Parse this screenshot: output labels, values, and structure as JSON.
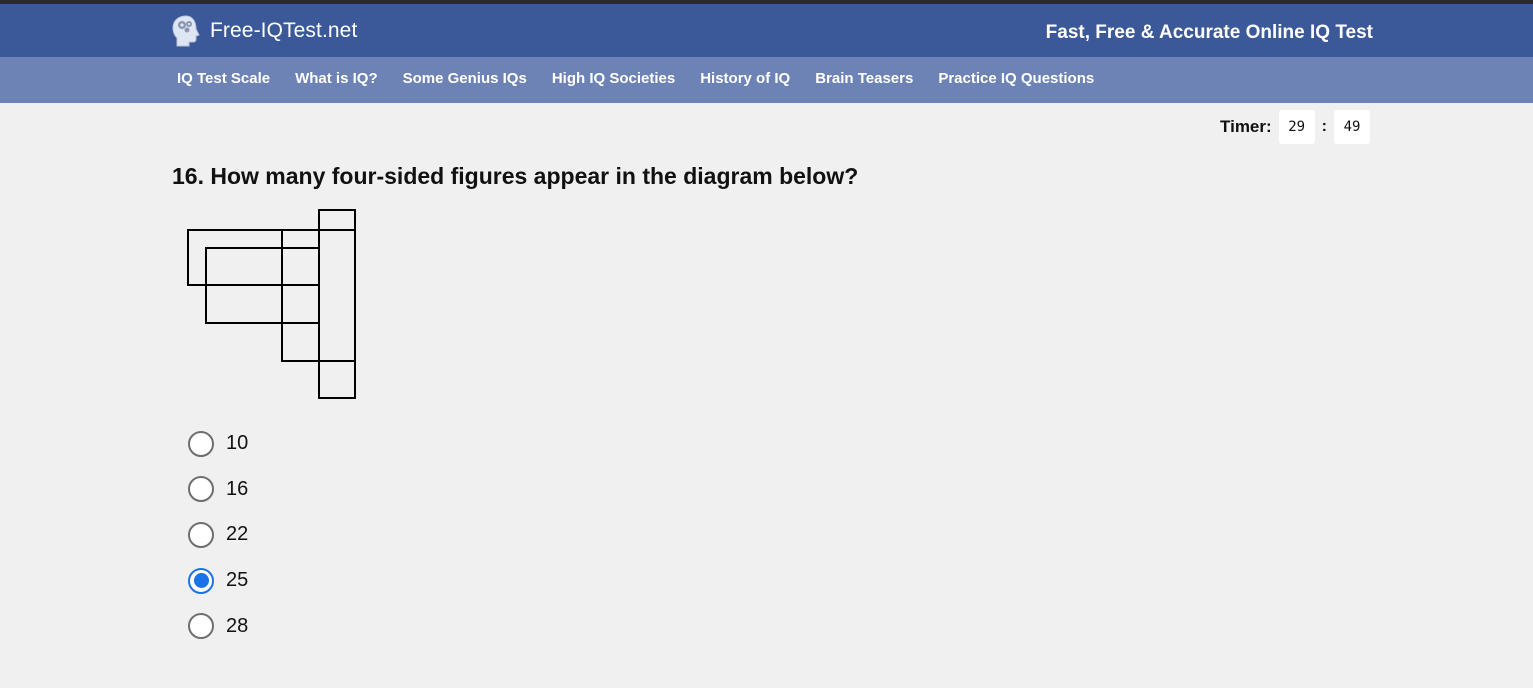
{
  "header": {
    "logo_text": "Free-IQTest.net",
    "tagline": "Fast, Free & Accurate Online IQ Test",
    "bg_color": "#3b5998"
  },
  "nav": {
    "bg_color": "#6d83b6",
    "items": [
      {
        "label": "IQ Test Scale"
      },
      {
        "label": "What is IQ?"
      },
      {
        "label": "Some Genius IQs"
      },
      {
        "label": "High IQ Societies"
      },
      {
        "label": "History of IQ"
      },
      {
        "label": "Brain Teasers"
      },
      {
        "label": "Practice IQ Questions"
      }
    ]
  },
  "timer": {
    "label": "Timer:",
    "minutes": "29",
    "separator": ":",
    "seconds": "49"
  },
  "question": {
    "text": "16. How many four-sided figures appear in the diagram below?",
    "options": [
      {
        "label": "10",
        "selected": false
      },
      {
        "label": "16",
        "selected": false
      },
      {
        "label": "22",
        "selected": false
      },
      {
        "label": "25",
        "selected": true
      },
      {
        "label": "28",
        "selected": false
      }
    ],
    "selected_color": "#1a73e8"
  }
}
